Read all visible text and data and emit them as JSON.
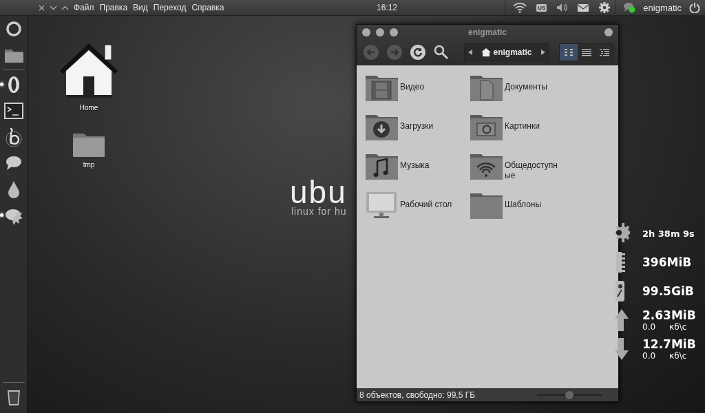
{
  "top_panel": {
    "window_controls": [
      {
        "kind": "close"
      },
      {
        "kind": "minimize"
      },
      {
        "kind": "maximize"
      }
    ],
    "app_menu": [
      "Файл",
      "Правка",
      "Вид",
      "Переход",
      "Справка"
    ],
    "clock": "16:12",
    "keyboard_layout": "US",
    "user": "enigmatic"
  },
  "launcher": {
    "items": [
      {
        "kind": "dash",
        "running": false
      },
      {
        "kind": "files",
        "running": false
      },
      {
        "kind": "separator"
      },
      {
        "kind": "browser",
        "running": true
      },
      {
        "kind": "terminal",
        "running": false
      },
      {
        "kind": "b-app",
        "running": false
      },
      {
        "kind": "chat",
        "running": false
      },
      {
        "kind": "drop",
        "running": false
      },
      {
        "kind": "gear-blob",
        "running": true
      }
    ],
    "trash": {
      "running": false
    }
  },
  "desktop": {
    "wallpaper": {
      "logo": "ubu",
      "tagline": "linux for hu"
    },
    "icons": [
      {
        "kind": "home",
        "label": "Home"
      },
      {
        "kind": "folder",
        "label": "tmp"
      }
    ]
  },
  "file_manager": {
    "title": "enigmatic",
    "path": "enigmatic",
    "views": [
      {
        "kind": "icons",
        "selected": true
      },
      {
        "kind": "list",
        "selected": false
      },
      {
        "kind": "compact",
        "selected": false
      }
    ],
    "items": [
      {
        "kind": "video",
        "name": "Видео"
      },
      {
        "kind": "documents",
        "name": "Документы"
      },
      {
        "kind": "downloads",
        "name": "Загрузки"
      },
      {
        "kind": "pictures",
        "name": "Картинки"
      },
      {
        "kind": "music",
        "name": "Музыка"
      },
      {
        "kind": "public",
        "name": "Общедоступные"
      },
      {
        "kind": "desktop",
        "name": "Рабочий стол"
      },
      {
        "kind": "folder",
        "name": "Шаблоны"
      }
    ],
    "status": "8 объектов, свободно: 99,5 ГБ",
    "zoom": {
      "level": 0.5
    }
  },
  "system_monitor": {
    "rows": [
      {
        "kind": "uptime",
        "value": "2h 38m 9s"
      },
      {
        "kind": "memory",
        "value": "396MiB"
      },
      {
        "kind": "disk",
        "value": "99.5GiB"
      },
      {
        "kind": "upload",
        "value": "2.63MiB",
        "rate": "0.0",
        "unit": "кб\\с"
      },
      {
        "kind": "download",
        "value": "12.7MiB",
        "rate": "0.0",
        "unit": "кб\\с"
      }
    ]
  }
}
